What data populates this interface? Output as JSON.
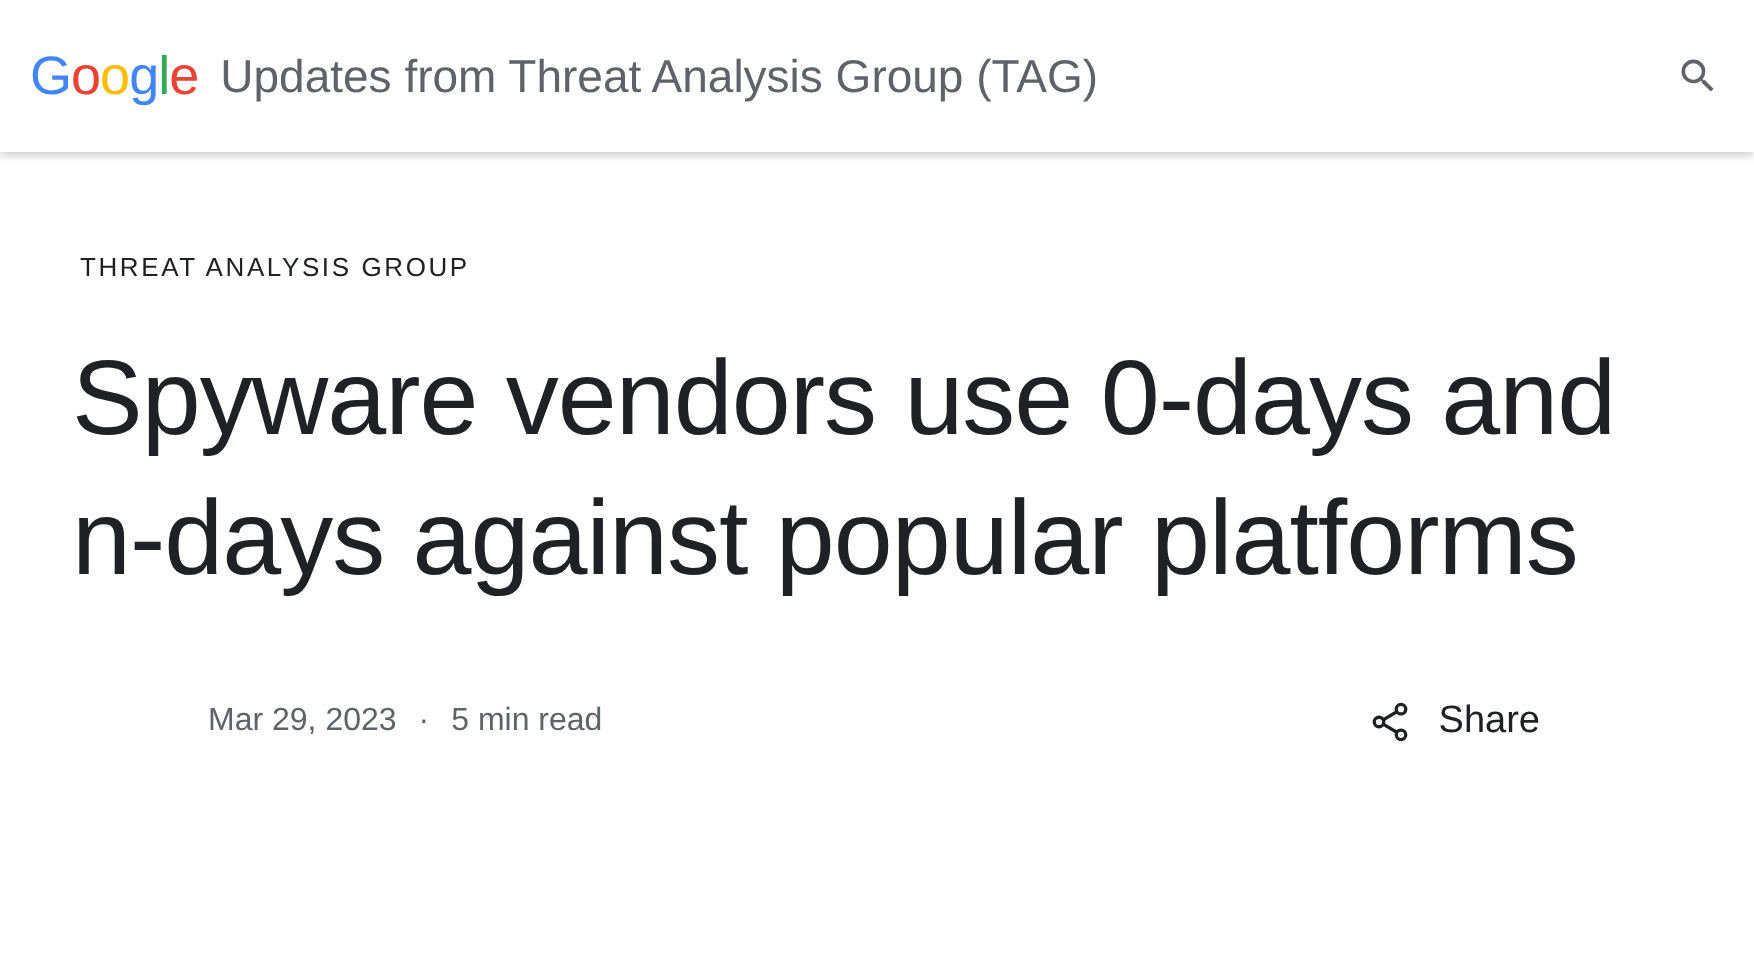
{
  "header": {
    "logo": [
      {
        "letter": "G",
        "color": "#4285f4"
      },
      {
        "letter": "o",
        "color": "#ea4335"
      },
      {
        "letter": "o",
        "color": "#fbbc05"
      },
      {
        "letter": "g",
        "color": "#4285f4"
      },
      {
        "letter": "l",
        "color": "#34a853"
      },
      {
        "letter": "e",
        "color": "#ea4335"
      }
    ],
    "title": "Updates from Threat Analysis Group (TAG)"
  },
  "article": {
    "category": "THREAT ANALYSIS GROUP",
    "headline": "Spyware vendors use 0-days and n-days against popular platforms",
    "date": "Mar 29, 2023",
    "separator": "·",
    "read_time": "5 min read",
    "share": "Share"
  }
}
